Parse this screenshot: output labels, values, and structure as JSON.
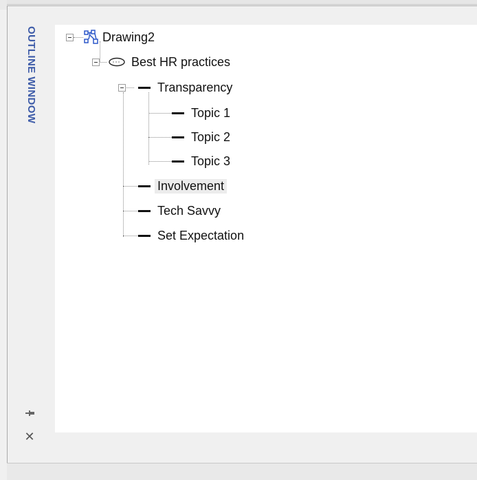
{
  "panel": {
    "title": "OUTLINE WINDOW"
  },
  "tree": {
    "root": "Drawing2",
    "main_topic": "Best HR practices",
    "subtopic_transparency": "Transparency",
    "topics": [
      "Topic 1",
      "Topic 2",
      "Topic 3"
    ],
    "subtopic_involvement": "Involvement",
    "subtopic_tech": "Tech Savvy",
    "subtopic_expectation": "Set Expectation"
  },
  "colors": {
    "title": "#3d5ba8",
    "drawing_icon": "#2b57c8"
  },
  "icons": {
    "pin": "pin-icon",
    "close": "close-icon",
    "drawing": "drawing-icon",
    "ellipse": "ellipse-shape-icon",
    "topic": "topic-line-icon"
  }
}
